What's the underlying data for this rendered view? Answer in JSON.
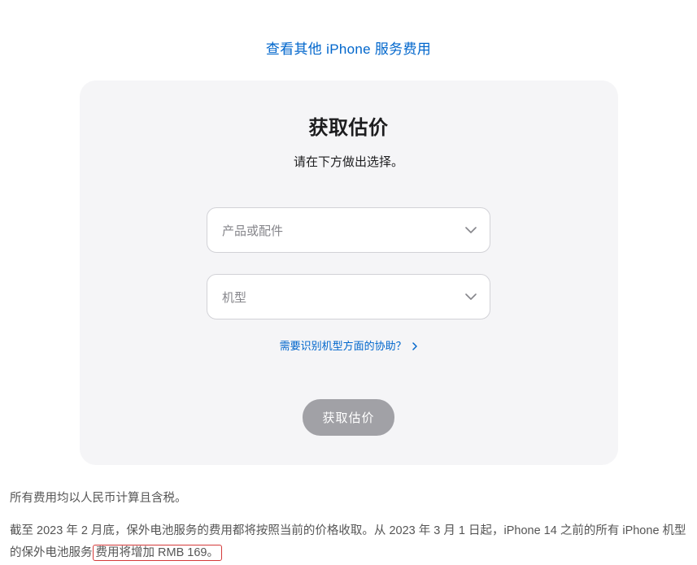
{
  "topLink": {
    "label": "查看其他 iPhone 服务费用"
  },
  "card": {
    "title": "获取估价",
    "subtitle": "请在下方做出选择。",
    "select1": {
      "placeholder": "产品或配件"
    },
    "select2": {
      "placeholder": "机型"
    },
    "helpLink": "需要识别机型方面的协助？",
    "submitLabel": "获取估价"
  },
  "footer": {
    "line1": "所有费用均以人民币计算且含税。",
    "line2_part1": "截至 2023 年 2 月底，保外电池服务的费用都将按照当前的价格收取。从 2023 年 3 月 1 日起，iPhone 14 之前的所有 iPhone 机型的保外电池服务",
    "line2_highlight": "费用将增加 RMB 169。"
  }
}
